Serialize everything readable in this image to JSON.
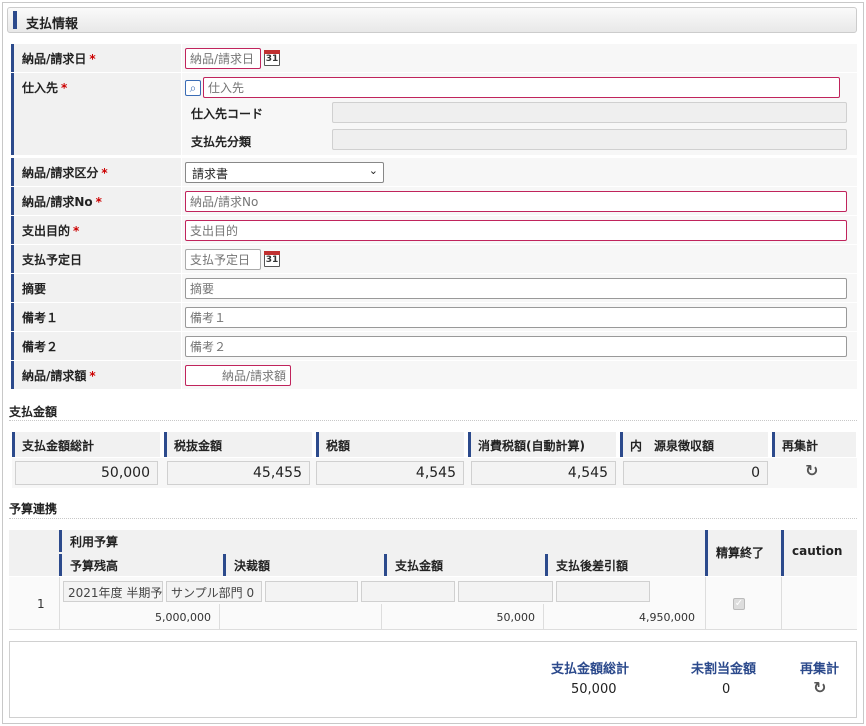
{
  "section": {
    "title": "支払情報"
  },
  "form": {
    "delivery_date": {
      "label": "納品/請求日",
      "placeholder": "納品/請求日",
      "required": "*"
    },
    "calendar_day": "31",
    "supplier": {
      "label": "仕入先",
      "placeholder": "仕入先",
      "required": "*"
    },
    "supplier_code": {
      "label": "仕入先コード"
    },
    "payee_type": {
      "label": "支払先分類"
    },
    "doc_type": {
      "label": "納品/請求区分",
      "required": "*",
      "value": "請求書"
    },
    "doc_no": {
      "label": "納品/請求No",
      "placeholder": "納品/請求No",
      "required": "*"
    },
    "purpose": {
      "label": "支出目的",
      "placeholder": "支出目的",
      "required": "*"
    },
    "scheduled_date": {
      "label": "支払予定日",
      "placeholder": "支払予定日"
    },
    "summary": {
      "label": "摘要",
      "placeholder": "摘要"
    },
    "note1": {
      "label": "備考１",
      "placeholder": "備考１"
    },
    "note2": {
      "label": "備考２",
      "placeholder": "備考２"
    },
    "amount": {
      "label": "納品/請求額",
      "placeholder": "納品/請求額",
      "required": "*"
    }
  },
  "payment": {
    "title": "支払金額",
    "headers": [
      "支払金額総計",
      "税抜金額",
      "税額",
      "消費税額(自動計算)",
      "内　源泉徴収額",
      "再集計"
    ],
    "values": [
      "50,000",
      "45,455",
      "4,545",
      "4,545",
      "0"
    ]
  },
  "budget": {
    "title": "予算連携",
    "group_header": "利用予算",
    "headers": [
      "予算残高",
      "決裁額",
      "支払金額",
      "支払後差引額"
    ],
    "settled_header": "精算終了",
    "caution_header": "caution",
    "row": {
      "index": "1",
      "budget_name": "2021年度 半期予",
      "dept_name": "サンプル部門 0",
      "balance": "5,000,000",
      "payment": "50,000",
      "after": "4,950,000",
      "check_mark": "✓"
    }
  },
  "summary": {
    "total_label": "支払金額総計",
    "unassigned_label": "未割当金額",
    "recalc_label": "再集計",
    "total_value": "50,000",
    "unassigned_value": "0"
  },
  "icons": {
    "refresh": "↻",
    "search": "⌕",
    "select_arrow": "⌄"
  }
}
